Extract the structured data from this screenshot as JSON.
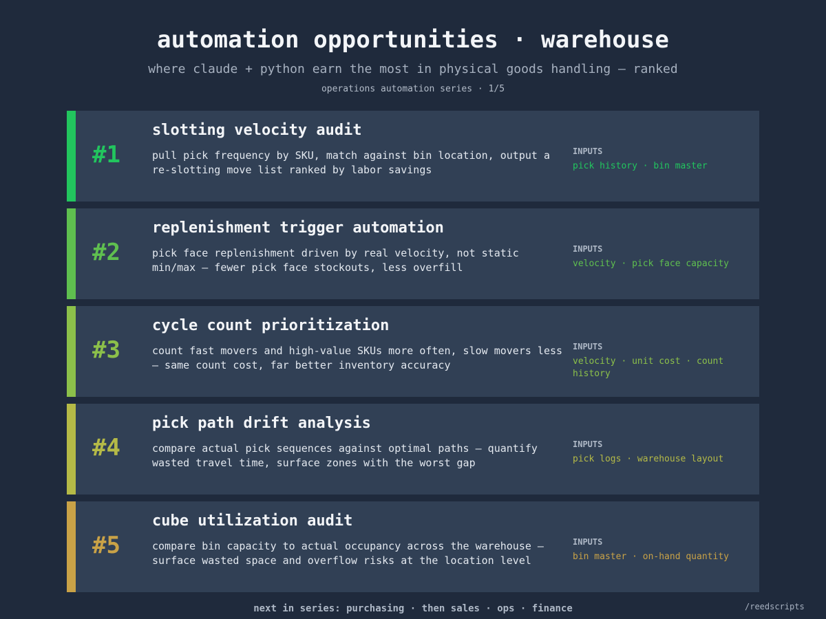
{
  "header": {
    "title": "automation opportunities · warehouse",
    "subtitle": "where claude + python earn the most in physical goods handling — ranked",
    "series": "operations automation series · 1/5"
  },
  "cards": [
    {
      "rank": "#1",
      "title": "slotting velocity audit",
      "description": "pull pick frequency by SKU, match against bin location, output a re-slotting move list ranked by labor savings",
      "inputs_label": "INPUTS",
      "inputs": "pick history · bin master",
      "color": "#22c55e"
    },
    {
      "rank": "#2",
      "title": "replenishment trigger automation",
      "description": "pick face replenishment driven by real velocity, not static min/max — fewer pick face stockouts, less overfill",
      "inputs_label": "INPUTS",
      "inputs": "velocity · pick face capacity",
      "color": "#5fbf4f"
    },
    {
      "rank": "#3",
      "title": "cycle count prioritization",
      "description": "count fast movers and high-value SKUs more often, slow movers less — same count cost, far better inventory accuracy",
      "inputs_label": "INPUTS",
      "inputs": "velocity · unit cost · count history",
      "color": "#8cc04a"
    },
    {
      "rank": "#4",
      "title": "pick path drift analysis",
      "description": "compare actual pick sequences against optimal paths — quantify wasted travel time, surface zones with the worst gap",
      "inputs_label": "INPUTS",
      "inputs": "pick logs · warehouse layout",
      "color": "#b5ba47"
    },
    {
      "rank": "#5",
      "title": "cube utilization audit",
      "description": "compare bin capacity to actual occupancy across the warehouse — surface wasted space and overflow risks at the location level",
      "inputs_label": "INPUTS",
      "inputs": "bin master · on-hand quantity",
      "color": "#c9a247"
    }
  ],
  "footer": {
    "next": "next in series: purchasing · then sales · ops · finance",
    "handle": "/reedscripts"
  }
}
